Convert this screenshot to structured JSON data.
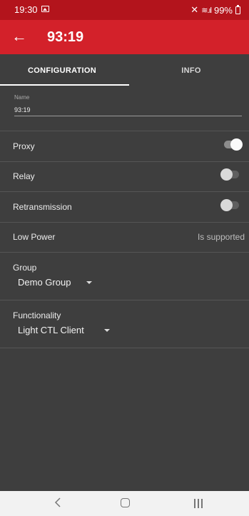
{
  "status_bar": {
    "time": "19:30",
    "battery": "99%",
    "signal": "≋.ıl"
  },
  "app_bar": {
    "back_glyph": "←",
    "title": "93:19"
  },
  "tabs": [
    {
      "label": "CONFIGURATION",
      "active": true
    },
    {
      "label": "INFO",
      "active": false
    }
  ],
  "name_field": {
    "label": "Name",
    "value": "93:19"
  },
  "rows": {
    "proxy": {
      "label": "Proxy",
      "enabled": true
    },
    "relay": {
      "label": "Relay",
      "enabled": false
    },
    "retransmission": {
      "label": "Retransmission",
      "enabled": false
    },
    "low_power": {
      "label": "Low Power",
      "value": "Is supported"
    }
  },
  "group": {
    "label": "Group",
    "selected": "Demo Group"
  },
  "functionality": {
    "label": "Functionality",
    "selected": "Light CTL Client"
  },
  "nav_bar": {
    "back_glyph": "‹"
  },
  "colors": {
    "status_bar": "#b3141c",
    "app_bar": "#d3212a",
    "background": "#3e3e3e",
    "nav_bar": "#f2f2f2"
  }
}
